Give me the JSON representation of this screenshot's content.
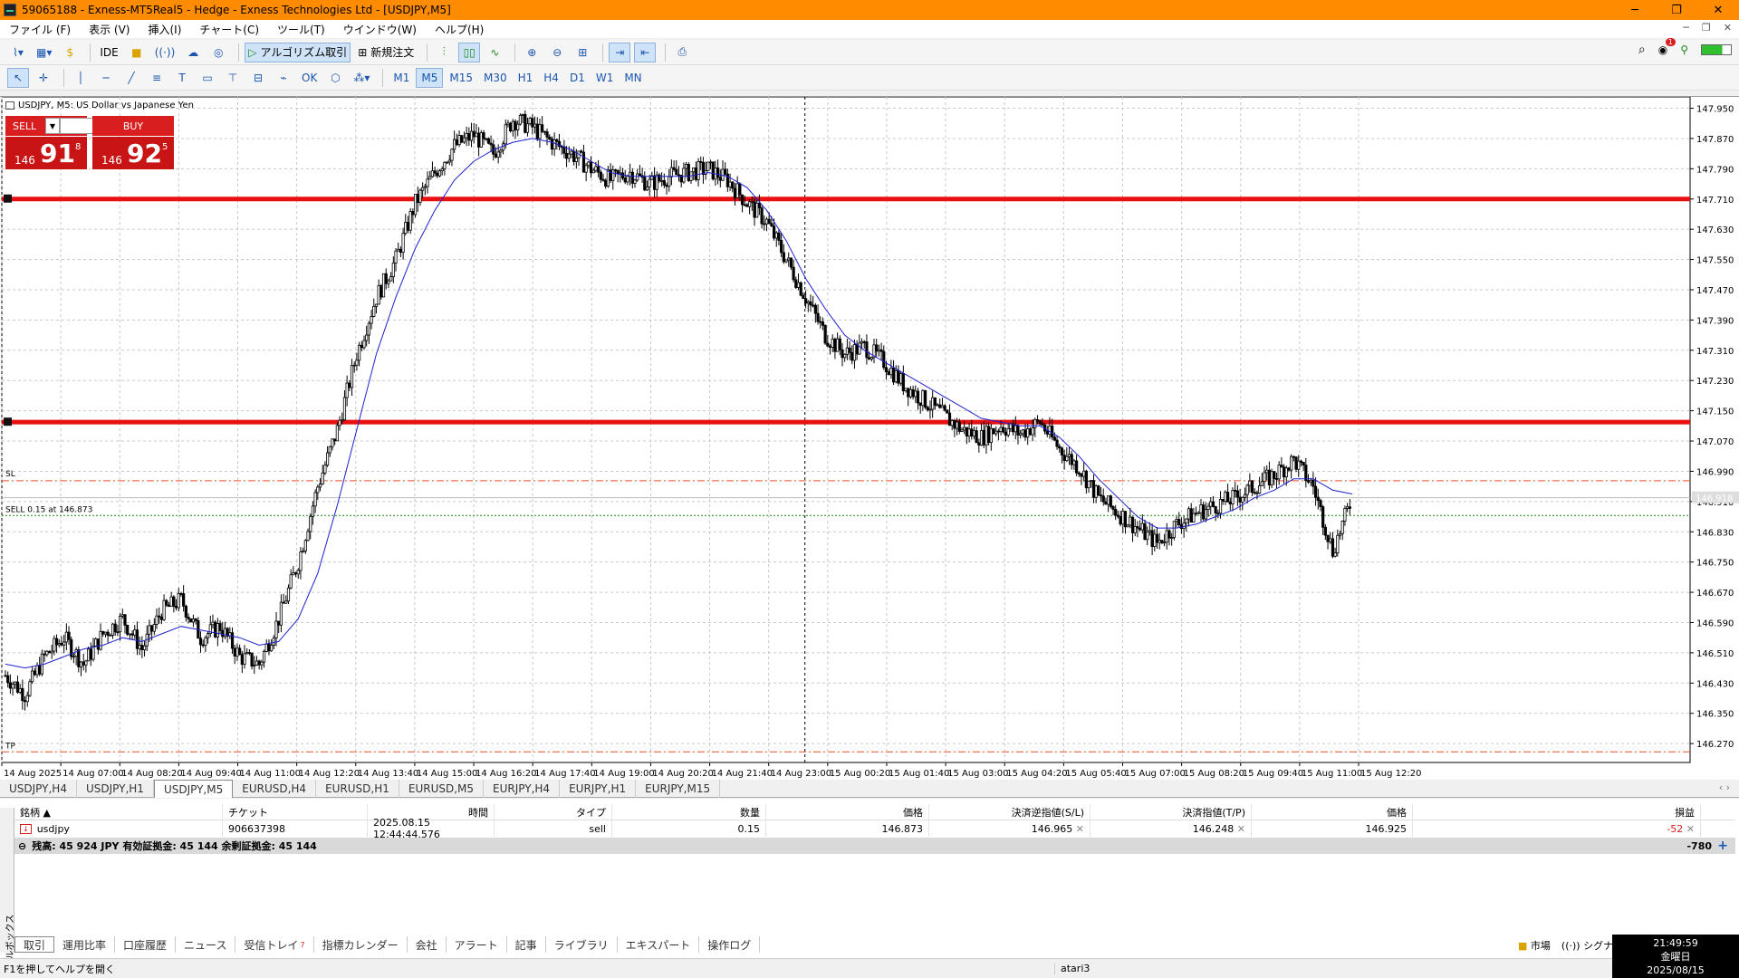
{
  "window": {
    "title": "59065188 - Exness-MT5Real5 - Hedge - Exness Technologies Ltd - [USDJPY,M5]"
  },
  "menu": [
    "ファイル (F)",
    "表示 (V)",
    "挿入(I)",
    "チャート(C)",
    "ツール(T)",
    "ウインドウ(W)",
    "ヘルプ(H)"
  ],
  "toolbar": {
    "ide": "IDE",
    "algo": "アルゴリズム取引",
    "neworder": "新規注文",
    "notif_count": "1"
  },
  "timeframes": [
    "M1",
    "M5",
    "M15",
    "M30",
    "H1",
    "H4",
    "D1",
    "W1",
    "MN"
  ],
  "active_timeframe": "M5",
  "chart": {
    "header": "USDJPY, M5:  US Dollar vs Japanese Yen",
    "sell_label": "SELL",
    "buy_label": "BUY",
    "lot": "0.15",
    "sell_prefix": "146",
    "sell_big": "91",
    "sell_sup": "8",
    "buy_prefix": "146",
    "buy_big": "92",
    "buy_sup": "5",
    "sl_label": "SL",
    "tp_label": "TP",
    "position_label": "SELL 0.15 at 146.873",
    "current_price": "146.918",
    "colors": {
      "hline": "#e81010",
      "ma": "#2020d0",
      "candle": "#000000",
      "sl": "#e8502a",
      "entry": "#1a8a1a"
    }
  },
  "chart_data": {
    "type": "line",
    "title": "USDJPY, M5:  US Dollar vs Japanese Yen",
    "x_ticks": [
      "14 Aug 2025",
      "14 Aug 07:00",
      "14 Aug 08:20",
      "14 Aug 09:40",
      "14 Aug 11:00",
      "14 Aug 12:20",
      "14 Aug 13:40",
      "14 Aug 15:00",
      "14 Aug 16:20",
      "14 Aug 17:40",
      "14 Aug 19:00",
      "14 Aug 20:20",
      "14 Aug 21:40",
      "14 Aug 23:00",
      "15 Aug 00:20",
      "15 Aug 01:40",
      "15 Aug 03:00",
      "15 Aug 04:20",
      "15 Aug 05:40",
      "15 Aug 07:00",
      "15 Aug 08:20",
      "15 Aug 09:40",
      "15 Aug 11:00",
      "15 Aug 12:20"
    ],
    "y_ticks": [
      "147.950",
      "147.870",
      "147.790",
      "147.710",
      "147.630",
      "147.550",
      "147.470",
      "147.390",
      "147.310",
      "147.230",
      "147.150",
      "147.070",
      "146.990",
      "146.910",
      "146.830",
      "146.750",
      "146.670",
      "146.590",
      "146.510",
      "146.430",
      "146.350",
      "146.270"
    ],
    "ylim": [
      146.22,
      147.98
    ],
    "price_path": [
      146.45,
      146.4,
      146.5,
      146.55,
      146.48,
      146.56,
      146.6,
      146.52,
      146.62,
      146.65,
      146.55,
      146.58,
      146.5,
      146.48,
      146.6,
      146.75,
      146.95,
      147.1,
      147.3,
      147.45,
      147.55,
      147.7,
      147.78,
      147.85,
      147.88,
      147.83,
      147.92,
      147.9,
      147.86,
      147.83,
      147.79,
      147.76,
      147.78,
      147.75,
      147.77,
      147.78,
      147.79,
      147.76,
      147.7,
      147.65,
      147.55,
      147.45,
      147.35,
      147.3,
      147.32,
      147.28,
      147.22,
      147.18,
      147.14,
      147.1,
      147.08,
      147.11,
      147.09,
      147.12,
      147.05,
      147.0,
      146.92,
      146.88,
      146.84,
      146.8,
      146.85,
      146.88,
      146.9,
      146.92,
      146.95,
      146.98,
      147.02,
      146.95,
      146.78,
      146.92
    ],
    "ma_path": [
      146.48,
      146.47,
      146.48,
      146.5,
      146.52,
      146.53,
      146.55,
      146.54,
      146.56,
      146.58,
      146.57,
      146.56,
      146.55,
      146.53,
      146.54,
      146.6,
      146.72,
      146.9,
      147.1,
      147.3,
      147.45,
      147.58,
      147.68,
      147.76,
      147.81,
      147.84,
      147.86,
      147.87,
      147.86,
      147.84,
      147.81,
      147.78,
      147.77,
      147.77,
      147.77,
      147.77,
      147.78,
      147.77,
      147.74,
      147.68,
      147.6,
      147.5,
      147.42,
      147.35,
      147.31,
      147.28,
      147.25,
      147.22,
      147.19,
      147.16,
      147.13,
      147.12,
      147.11,
      147.11,
      147.08,
      147.03,
      146.97,
      146.92,
      146.87,
      146.84,
      146.84,
      146.85,
      146.87,
      146.89,
      146.92,
      146.94,
      146.97,
      146.97,
      146.94,
      146.93
    ],
    "hlines": [
      147.71,
      147.12
    ],
    "sl": 146.965,
    "tp": 146.248,
    "entry": 146.873
  },
  "symbol_tabs": [
    "USDJPY,H4",
    "USDJPY,H1",
    "USDJPY,M5",
    "EURUSD,H4",
    "EURUSD,H1",
    "EURUSD,M5",
    "EURJPY,H4",
    "EURJPY,H1",
    "EURJPY,M15"
  ],
  "active_symbol_tab": "USDJPY,M5",
  "positions": {
    "headers": [
      "銘柄",
      "チケット",
      "時間",
      "タイプ",
      "数量",
      "価格",
      "決済逆指値(S/L)",
      "決済指値(T/P)",
      "価格",
      "損益"
    ],
    "row": {
      "symbol": "usdjpy",
      "ticket": "906637398",
      "time": "2025.08.15 12:44:44.576",
      "type": "sell",
      "volume": "0.15",
      "price": "146.873",
      "sl": "146.965",
      "tp": "146.248",
      "current": "146.925",
      "profit": "-52"
    },
    "balance_text": "残高: 45 924 JPY  有効証拠金: 45 144  余剰証拠金: 45 144",
    "total": "-780"
  },
  "toolbox_label": "ツールボックス",
  "bottom_tabs": [
    "取引",
    "運用比率",
    "口座履歴",
    "ニュース",
    "受信トレイ",
    "指標カレンダー",
    "会社",
    "アラート",
    "記事",
    "ライブラリ",
    "エキスパート",
    "操作ログ"
  ],
  "inbox_badge": "7",
  "status": {
    "help": "F1を押してヘルプを開く",
    "profile": "atari3",
    "market": "市場",
    "signal": "シグナル"
  },
  "clock": {
    "time": "21:49:59",
    "day": "金曜日",
    "date": "2025/08/15"
  }
}
